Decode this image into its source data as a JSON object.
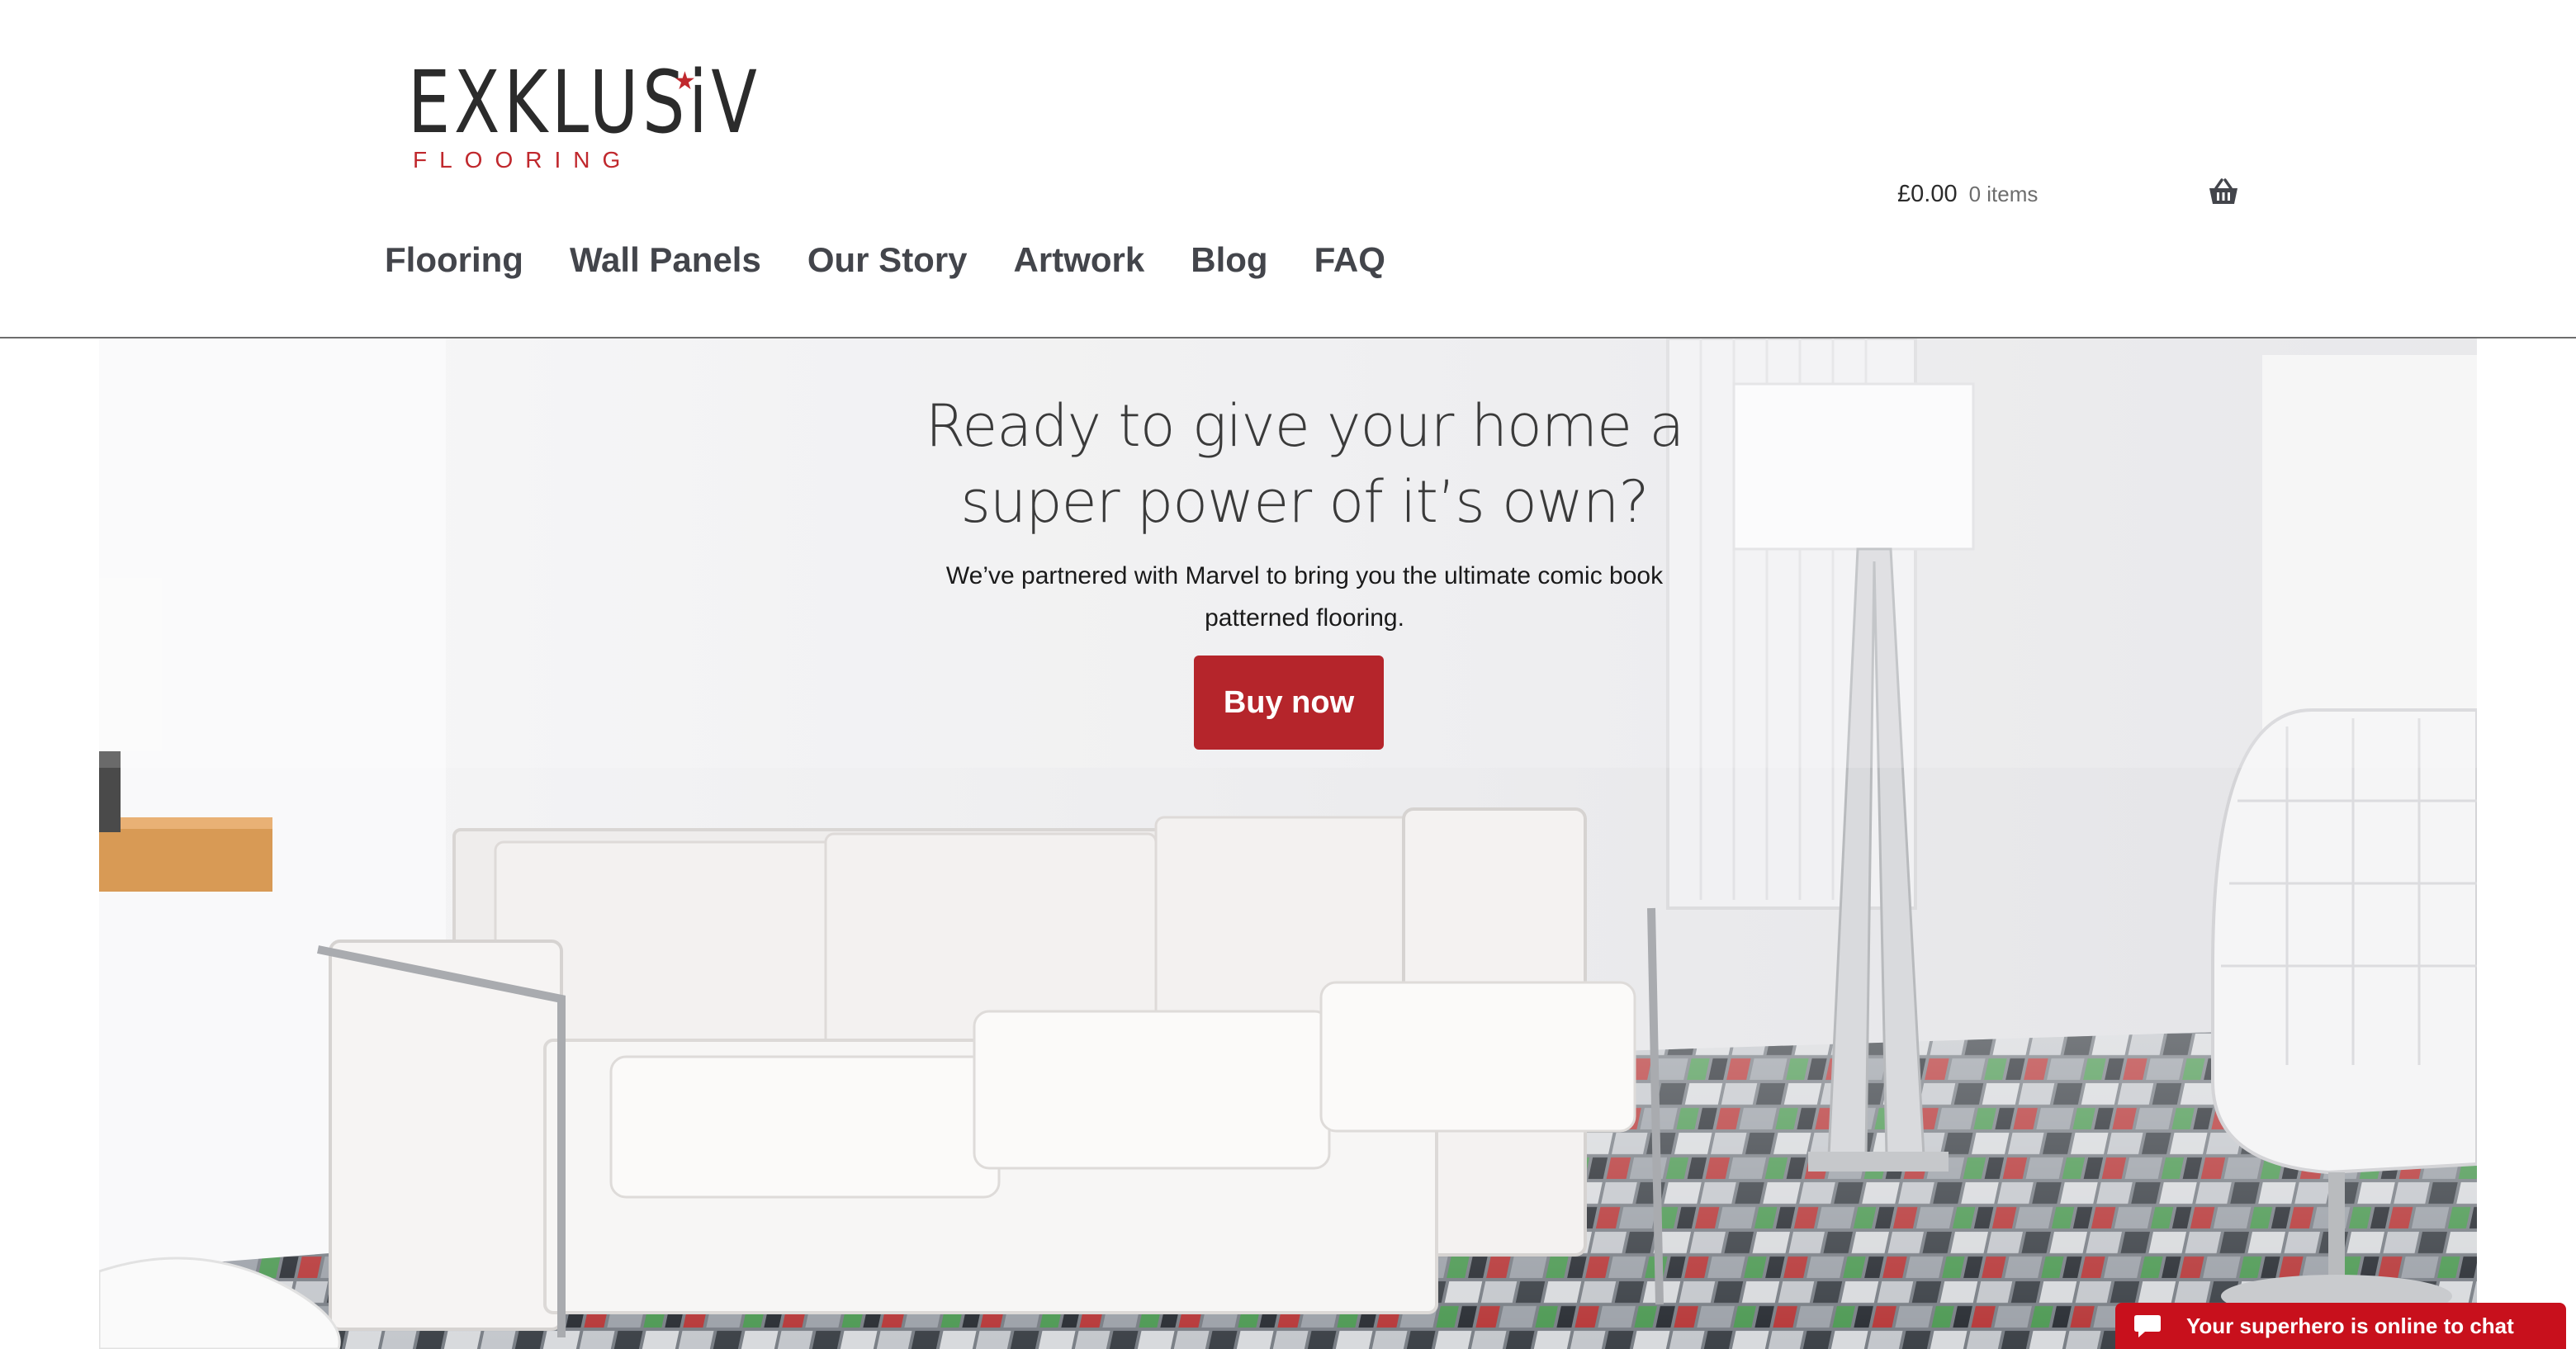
{
  "brand": {
    "logo_word": "EXKLUSiV",
    "logo_sub": "FLOORING",
    "accent_color": "#b5252b"
  },
  "nav": {
    "items": [
      {
        "label": "Flooring"
      },
      {
        "label": "Wall Panels"
      },
      {
        "label": "Our Story"
      },
      {
        "label": "Artwork"
      },
      {
        "label": "Blog"
      },
      {
        "label": "FAQ"
      }
    ]
  },
  "cart": {
    "amount": "£0.00",
    "count": "0 items",
    "icon": "basket-icon"
  },
  "hero": {
    "title": "Ready to give your home a super power of it’s own?",
    "subtitle": "We’ve partnered with Marvel to bring you the ultimate comic book patterned flooring.",
    "button_label": "Buy now"
  },
  "chat": {
    "label": "Your superhero is online to chat",
    "icon": "chat-bubble-icon",
    "color": "#c8101c"
  }
}
